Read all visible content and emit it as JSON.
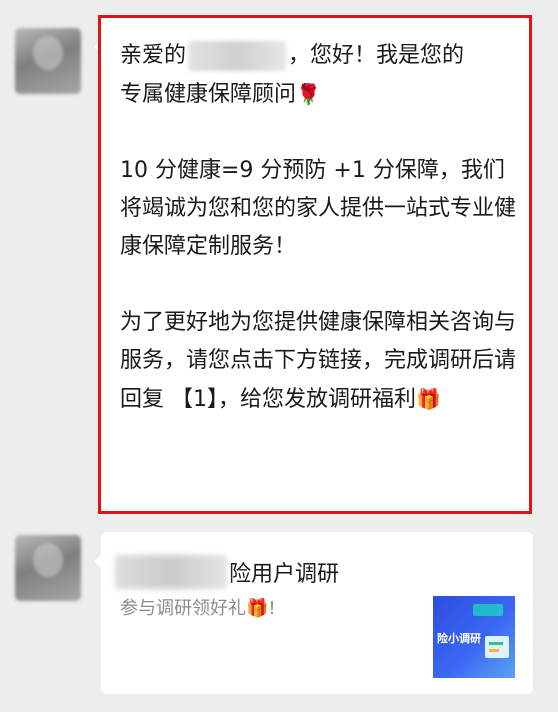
{
  "message": {
    "line1_before": "亲爱的",
    "line1_after": "，您好！我是您的",
    "line2": "专属健康保障顾问",
    "rose_emoji": "🌹",
    "para2": "10 分健康=9 分预防 +1 分保障，我们将竭诚为您和您的家人提供一站式专业健康保障定制服务！",
    "para3": "为了更好地为您提供健康保障相关咨询与服务，请您点击下方链接，完成调研后请回复 【1】，给您发放调研福利",
    "gift_emoji": "🎁"
  },
  "card": {
    "title_suffix": "险用户调研",
    "desc": "参与调研领好礼",
    "desc_emoji": "🎁",
    "desc_end": "!",
    "thumb_text": "险小调研"
  },
  "colors": {
    "highlight": "#e01414",
    "background": "#ededed"
  }
}
